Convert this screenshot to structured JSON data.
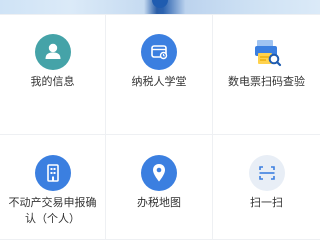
{
  "menu": {
    "items": [
      {
        "label": "我的信息",
        "icon": "user-icon",
        "color": "#45a3a8"
      },
      {
        "label": "纳税人学堂",
        "icon": "classroom-icon",
        "color": "#3b7fe0"
      },
      {
        "label": "数电票扫码查验",
        "icon": "printer-search-icon",
        "color": "#3b7fe0"
      },
      {
        "label": "不动产交易申报确认（个人）",
        "icon": "building-icon",
        "color": "#3b7fe0"
      },
      {
        "label": "办税地图",
        "icon": "location-pin-icon",
        "color": "#3b7fe0"
      },
      {
        "label": "扫一扫",
        "icon": "scan-icon",
        "color": "#e8eef6"
      }
    ]
  }
}
